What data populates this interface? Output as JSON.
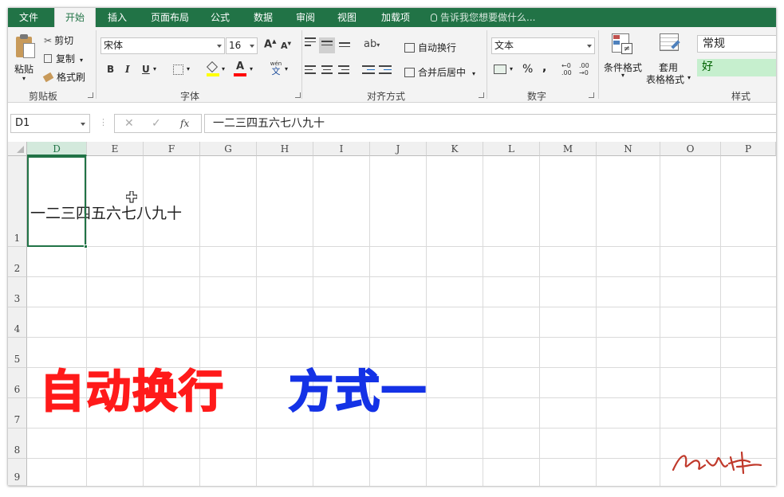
{
  "tabs": [
    "文件",
    "开始",
    "插入",
    "页面布局",
    "公式",
    "数据",
    "审阅",
    "视图",
    "加载项"
  ],
  "tell_me": "告诉我您想要做什么...",
  "clipboard": {
    "paste": "粘贴",
    "cut": "剪切",
    "copy": "复制",
    "format_painter": "格式刷",
    "group": "剪贴板"
  },
  "font": {
    "name": "宋体",
    "size": "16",
    "group": "字体",
    "bold": "B",
    "italic": "I",
    "underline": "U",
    "pinyin_label": "wén",
    "pinyin_glyph": "文"
  },
  "alignment": {
    "wrap_text": "自动换行",
    "merge_center": "合并后居中",
    "group": "对齐方式"
  },
  "number": {
    "format": "文本",
    "percent": "%",
    "comma": ",",
    "inc_decimal_top": "←0",
    "inc_decimal_bottom": ".00",
    "dec_decimal_top": ".00",
    "dec_decimal_bottom": "→0",
    "group": "数字"
  },
  "styles": {
    "conditional_format": "条件格式",
    "table_format_1": "套用",
    "table_format_2": "表格格式",
    "normal": "常规",
    "good": "好",
    "group": "样式"
  },
  "formula_bar": {
    "name_box": "D1",
    "fx": "fx",
    "content": "一二三四五六七八九十"
  },
  "grid": {
    "columns": [
      "D",
      "E",
      "F",
      "G",
      "H",
      "I",
      "J",
      "K",
      "L",
      "M",
      "N",
      "O",
      "P"
    ],
    "rows": [
      "1",
      "2",
      "3",
      "4",
      "5",
      "6",
      "7",
      "8",
      "9"
    ],
    "selected_column": "D",
    "cell_D1": "一二三四五六七八九十"
  },
  "overlay": {
    "caption_red": "自动换行",
    "caption_blue": "方式一",
    "red_color": "#ff1a1a",
    "blue_color": "#1432e6",
    "signature": "然之峰"
  },
  "colors": {
    "excel_green": "#217346",
    "highlight_yellow": "#ffff00",
    "font_red": "#ff0000",
    "good_bg": "#c6efce",
    "good_fg": "#006100"
  }
}
